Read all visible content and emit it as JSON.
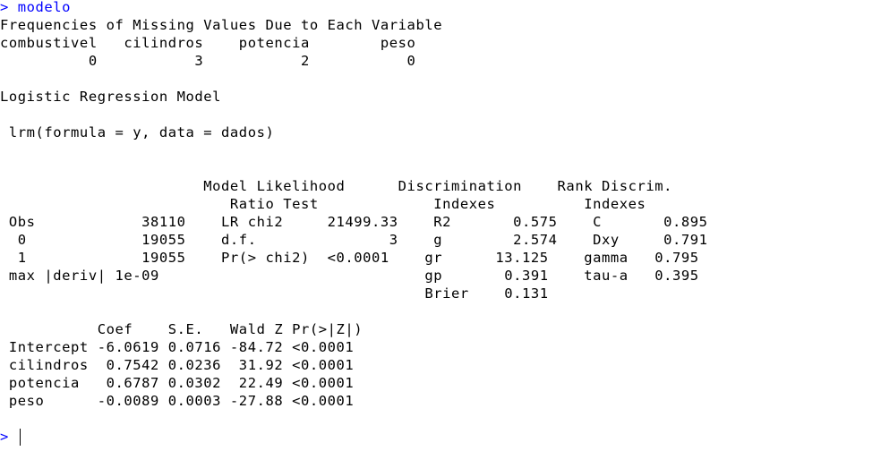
{
  "console": {
    "prompt_symbol": ">",
    "caret": "|",
    "lines": [
      {
        "kind": "prompt",
        "text": "> modelo"
      },
      {
        "kind": "output",
        "text": "Frequencies of Missing Values Due to Each Variable"
      },
      {
        "kind": "output",
        "text": "combustivel   cilindros    potencia        peso"
      },
      {
        "kind": "output",
        "text": "          0           3           2           0"
      },
      {
        "kind": "output",
        "text": ""
      },
      {
        "kind": "output",
        "text": "Logistic Regression Model"
      },
      {
        "kind": "output",
        "text": ""
      },
      {
        "kind": "output",
        "text": " lrm(formula = y, data = dados)"
      },
      {
        "kind": "output",
        "text": ""
      },
      {
        "kind": "output",
        "text": ""
      },
      {
        "kind": "output",
        "text": "                       Model Likelihood      Discrimination    Rank Discrim.    "
      },
      {
        "kind": "output",
        "text": "                          Ratio Test             Indexes          Indexes       "
      },
      {
        "kind": "output",
        "text": " Obs            38110    LR chi2     21499.33    R2       0.575    C       0.895    "
      },
      {
        "kind": "output",
        "text": "  0             19055    d.f.               3    g        2.574    Dxy     0.791    "
      },
      {
        "kind": "output",
        "text": "  1             19055    Pr(> chi2)  <0.0001    gr      13.125    gamma   0.795    "
      },
      {
        "kind": "output",
        "text": " max |deriv| 1e-09                              gp       0.391    tau-a   0.395    "
      },
      {
        "kind": "output",
        "text": "                                                Brier    0.131                     "
      },
      {
        "kind": "output",
        "text": ""
      },
      {
        "kind": "output",
        "text": "           Coef    S.E.   Wald Z Pr(>|Z|)"
      },
      {
        "kind": "output",
        "text": " Intercept -6.0619 0.0716 -84.72 <0.0001 "
      },
      {
        "kind": "output",
        "text": " cilindros  0.7542 0.0236  31.92 <0.0001 "
      },
      {
        "kind": "output",
        "text": " potencia   0.6787 0.0302  22.49 <0.0001 "
      },
      {
        "kind": "output",
        "text": " peso      -0.0089 0.0003 -27.88 <0.0001 "
      },
      {
        "kind": "output",
        "text": ""
      },
      {
        "kind": "prompt",
        "text": "> "
      }
    ]
  },
  "colors": {
    "background": "#ffffff",
    "prompt": "#0000ff",
    "output": "#000000"
  }
}
